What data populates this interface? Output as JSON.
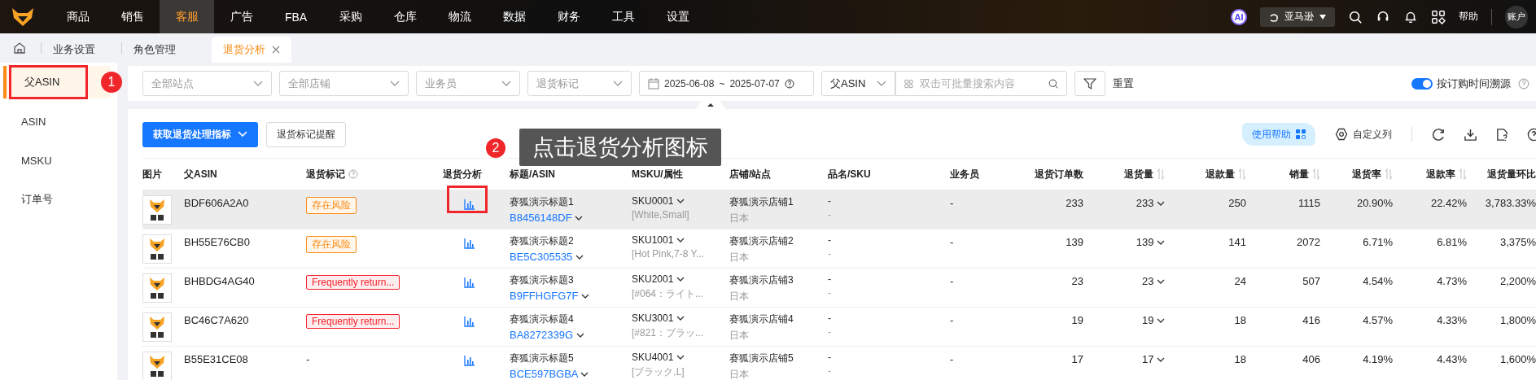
{
  "nav": {
    "items": [
      {
        "label": "商品",
        "selected": false
      },
      {
        "label": "销售",
        "selected": false
      },
      {
        "label": "客服",
        "selected": true
      },
      {
        "label": "广告",
        "selected": false
      },
      {
        "label": "FBA",
        "selected": false
      },
      {
        "label": "采购",
        "selected": false
      },
      {
        "label": "仓库",
        "selected": false
      },
      {
        "label": "物流",
        "selected": false
      },
      {
        "label": "数据",
        "selected": false
      },
      {
        "label": "财务",
        "selected": false
      },
      {
        "label": "工具",
        "selected": false
      },
      {
        "label": "设置",
        "selected": false
      }
    ],
    "ai_badge": "AI",
    "marketplace": "亚马逊",
    "help": "帮助",
    "account": "账户"
  },
  "tabs": [
    {
      "label": "业务设置",
      "selected": false
    },
    {
      "label": "角色管理",
      "selected": false
    },
    {
      "label": "退货分析",
      "selected": true
    }
  ],
  "sidebar": {
    "items": [
      {
        "label": "父ASIN",
        "selected": true
      },
      {
        "label": "ASIN",
        "selected": false
      },
      {
        "label": "MSKU",
        "selected": false
      },
      {
        "label": "订单号",
        "selected": false
      }
    ]
  },
  "filters": {
    "selects": [
      {
        "placeholder": "全部站点"
      },
      {
        "placeholder": "全部店铺"
      },
      {
        "placeholder": "业务员"
      },
      {
        "placeholder": "退货标记"
      }
    ],
    "date_start": "2025-06-08",
    "date_separator": "~",
    "date_end": "2025-07-07",
    "search_type": "父ASIN",
    "search_placeholder": "双击可批量搜索内容",
    "reset": "重置",
    "trace_toggle": {
      "label": "按订购时间溯源",
      "on": true
    }
  },
  "toolbar": {
    "primary_button": "获取退货处理指标",
    "remind_button": "退货标记提醒",
    "help_button": "使用帮助",
    "columns_button": "自定义列"
  },
  "table": {
    "columns": [
      {
        "label": "图片",
        "sortable": false,
        "help": false
      },
      {
        "label": "父ASIN",
        "sortable": false,
        "help": false
      },
      {
        "label": "退货标记",
        "sortable": false,
        "help": true
      },
      {
        "label": "退货分析",
        "sortable": false,
        "help": false
      },
      {
        "label": "标题/ASIN",
        "sortable": false,
        "help": false
      },
      {
        "label": "MSKU/属性",
        "sortable": false,
        "help": false
      },
      {
        "label": "店铺/站点",
        "sortable": false,
        "help": false
      },
      {
        "label": "品名/SKU",
        "sortable": false,
        "help": false
      },
      {
        "label": "业务员",
        "sortable": false,
        "help": false
      },
      {
        "label": "退货订单数",
        "sortable": false,
        "help": false
      },
      {
        "label": "退货量",
        "sortable": true,
        "help": false
      },
      {
        "label": "退款量",
        "sortable": true,
        "help": false
      },
      {
        "label": "销量",
        "sortable": true,
        "help": false
      },
      {
        "label": "退货率",
        "sortable": true,
        "help": false
      },
      {
        "label": "退款率",
        "sortable": true,
        "help": false
      },
      {
        "label": "退货量环比",
        "sortable": false,
        "help": false
      }
    ],
    "rows": [
      {
        "highlighted": true,
        "parent_asin": "BDF606A2A0",
        "tag": {
          "text": "存在风险",
          "color": "#fa8c16"
        },
        "title": "赛狐演示标题1",
        "asin": "B8456148DF",
        "sku": "SKU0001",
        "attributes": "[White,Small]",
        "store": "赛狐演示店铺1",
        "region": "日本",
        "product_name": "-",
        "product_sku": "-",
        "salesperson": "-",
        "return_orders": "233",
        "returns": "233",
        "refunds": "250",
        "sales": "1115",
        "return_rate": "20.90%",
        "refund_rate": "22.42%",
        "return_change": "3,783.33%"
      },
      {
        "highlighted": false,
        "parent_asin": "BH55E76CB0",
        "tag": {
          "text": "存在风险",
          "color": "#fa8c16"
        },
        "title": "赛狐演示标题2",
        "asin": "BE5C305535",
        "sku": "SKU1001",
        "attributes": "[Hot Pink,7-8 Y...",
        "store": "赛狐演示店铺2",
        "region": "日本",
        "product_name": "-",
        "product_sku": "-",
        "salesperson": "-",
        "return_orders": "139",
        "returns": "139",
        "refunds": "141",
        "sales": "2072",
        "return_rate": "6.71%",
        "refund_rate": "6.81%",
        "return_change": "3,375%"
      },
      {
        "highlighted": false,
        "parent_asin": "BHBDG4AG40",
        "tag": {
          "text": "Frequently return...",
          "color": "#f5222d"
        },
        "title": "赛狐演示标题3",
        "asin": "B9FFHGFG7F",
        "sku": "SKU2001",
        "attributes": "[#064：ライト...",
        "store": "赛狐演示店铺3",
        "region": "日本",
        "product_name": "-",
        "product_sku": "-",
        "salesperson": "-",
        "return_orders": "23",
        "returns": "23",
        "refunds": "24",
        "sales": "507",
        "return_rate": "4.54%",
        "refund_rate": "4.73%",
        "return_change": "2,200%"
      },
      {
        "highlighted": false,
        "parent_asin": "BC46C7A620",
        "tag": {
          "text": "Frequently return...",
          "color": "#f5222d"
        },
        "title": "赛狐演示标题4",
        "asin": "BA8272339G",
        "sku": "SKU3001",
        "attributes": "[#821：ブラッ...",
        "store": "赛狐演示店铺4",
        "region": "日本",
        "product_name": "-",
        "product_sku": "-",
        "salesperson": "-",
        "return_orders": "19",
        "returns": "19",
        "refunds": "18",
        "sales": "416",
        "return_rate": "4.57%",
        "refund_rate": "4.33%",
        "return_change": "1,800%"
      },
      {
        "highlighted": false,
        "parent_asin": "B55E31CE08",
        "tag": {
          "text": "-"
        },
        "title": "赛狐演示标题5",
        "asin": "BCE597BGBA",
        "sku": "SKU4001",
        "attributes": "[ブラック,L]",
        "store": "赛狐演示店铺5",
        "region": "日本",
        "product_name": "-",
        "product_sku": "-",
        "salesperson": "-",
        "return_orders": "17",
        "returns": "17",
        "refunds": "18",
        "sales": "406",
        "return_rate": "4.19%",
        "refund_rate": "4.43%",
        "return_change": "1,600%"
      }
    ]
  },
  "annotations": [
    {
      "number": "1"
    },
    {
      "number": "2",
      "text": "点击退货分析图标"
    }
  ]
}
